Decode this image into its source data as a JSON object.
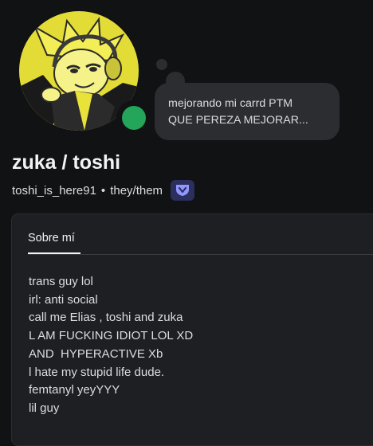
{
  "profile": {
    "display_name": "zuka / toshi",
    "username": "toshi_is_here91",
    "separator": "•",
    "pronouns": "they/them",
    "status": "online",
    "avatar_icon": "anime-character-avatar"
  },
  "custom_status": {
    "line1": "mejorando mi carrd PTM",
    "line2": "QUE PEREZA MEJORAR..."
  },
  "about": {
    "tab_label": "Sobre mí",
    "bio_lines": [
      "trans guy lol",
      "irl: anti social",
      "call me Elias , toshi and zuka",
      "L AM FUCKING IDIOT LOL XD",
      "AND  HYPERACTIVE Xb",
      "l hate my stupid life dude.",
      "femtanyl yeyYYY",
      "lil guy"
    ]
  },
  "colors": {
    "background": "#111214",
    "card": "#1e1f22",
    "online": "#23a55a",
    "avatar_yellow": "#e8e23a",
    "badge_bg": "#2c2e5c",
    "badge_icon": "#8f96ff"
  }
}
